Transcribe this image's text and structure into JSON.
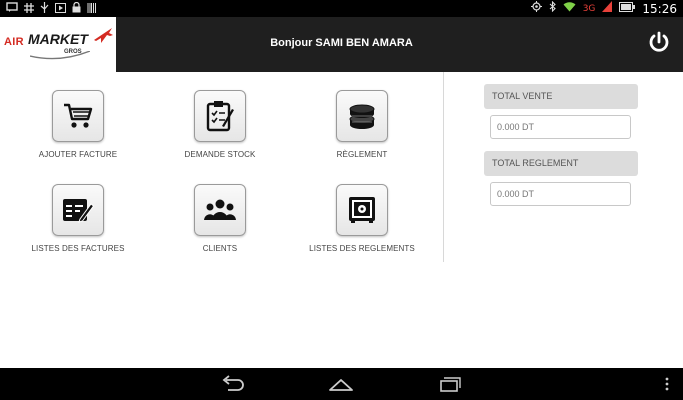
{
  "status_bar": {
    "left_icons": [
      "notification-icon",
      "hash-icon",
      "usb-icon",
      "play-icon",
      "lock-icon",
      "barcode-icon"
    ],
    "network": "3G",
    "time": "15:26"
  },
  "header": {
    "logo": {
      "air": "AIR",
      "market": "MARKET",
      "gros": "GROS"
    },
    "greeting": "Bonjour SAMI BEN AMARA"
  },
  "menu": {
    "items": [
      {
        "label": "AJOUTER FACTURE",
        "icon": "cart-icon"
      },
      {
        "label": "DEMANDE STOCK",
        "icon": "clipboard-icon"
      },
      {
        "label": "RÈGLEMENT",
        "icon": "coins-icon"
      },
      {
        "label": "LISTES DES FACTURES",
        "icon": "invoice-list-icon"
      },
      {
        "label": "CLIENTS",
        "icon": "clients-icon"
      },
      {
        "label": "LISTES DES REGLEMENTS",
        "icon": "safe-icon"
      }
    ]
  },
  "totals": {
    "vente": {
      "label": "TOTAL VENTE",
      "value": "0.000 DT"
    },
    "reglement": {
      "label": "TOTAL REGLEMENT",
      "value": "0.000 DT"
    }
  },
  "colors": {
    "appbar": "#1f1f1f",
    "brand_red": "#d42b22",
    "panel_head": "#dcdcdc"
  }
}
